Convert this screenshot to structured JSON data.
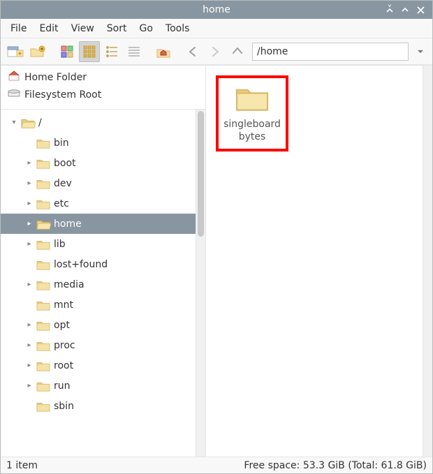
{
  "window": {
    "title": "home"
  },
  "menu": {
    "file": "File",
    "edit": "Edit",
    "view": "View",
    "sort": "Sort",
    "go": "Go",
    "tools": "Tools"
  },
  "path": {
    "value": "/home"
  },
  "places": {
    "home": "Home Folder",
    "root": "Filesystem Root"
  },
  "tree": {
    "root_label": "/",
    "items": [
      {
        "label": "bin",
        "expandable": false
      },
      {
        "label": "boot",
        "expandable": true
      },
      {
        "label": "dev",
        "expandable": true
      },
      {
        "label": "etc",
        "expandable": true
      },
      {
        "label": "home",
        "expandable": true,
        "selected": true
      },
      {
        "label": "lib",
        "expandable": true
      },
      {
        "label": "lost+found",
        "expandable": false
      },
      {
        "label": "media",
        "expandable": true
      },
      {
        "label": "mnt",
        "expandable": false
      },
      {
        "label": "opt",
        "expandable": true
      },
      {
        "label": "proc",
        "expandable": true
      },
      {
        "label": "root",
        "expandable": true
      },
      {
        "label": "run",
        "expandable": true
      },
      {
        "label": "sbin",
        "expandable": false
      }
    ]
  },
  "content": {
    "items": [
      {
        "name": "singleboardbytes",
        "display": "singleboard\nbytes"
      }
    ]
  },
  "status": {
    "left": "1 item",
    "right": "Free space: 53.3 GiB (Total: 61.8 GiB)"
  }
}
